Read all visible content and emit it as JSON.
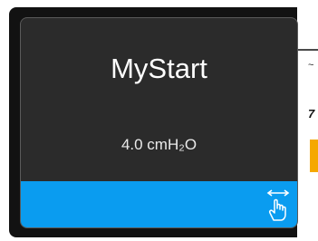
{
  "background": {
    "char1": "~",
    "char2": "7"
  },
  "card": {
    "title": "MyStart",
    "value": "4.0 cmH₂O"
  },
  "swipe_bar": {
    "icon": "swipe-hand-icon",
    "color": "#0a9cf0"
  },
  "colors": {
    "card_bg": "#2b2b2b",
    "accent": "#0a9cf0",
    "amber": "#f5a800"
  }
}
